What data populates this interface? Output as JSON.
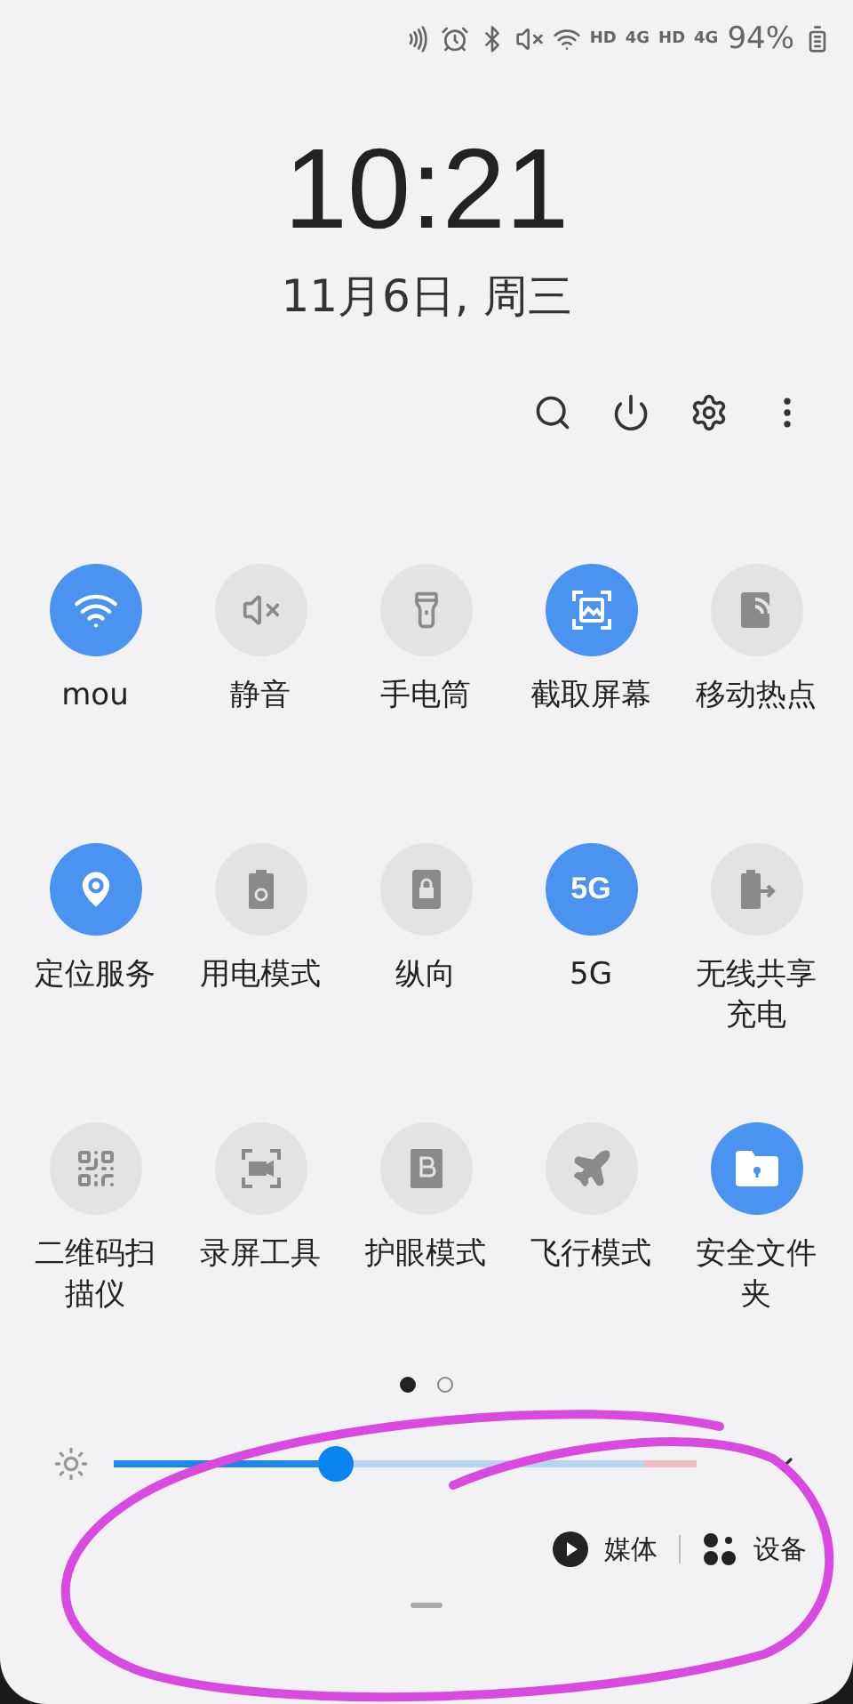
{
  "status_bar": {
    "texts": [
      "HD",
      "4G",
      "HD",
      "4G"
    ],
    "battery": "94%"
  },
  "clock": {
    "time": "10:21",
    "date": "11月6日, 周三"
  },
  "tiles": [
    {
      "label": "mou",
      "on": true
    },
    {
      "label": "静音",
      "on": false
    },
    {
      "label": "手电筒",
      "on": false
    },
    {
      "label": "截取屏幕",
      "on": true
    },
    {
      "label": "移动热点",
      "on": false
    },
    {
      "label": "定位服务",
      "on": true
    },
    {
      "label": "用电模式",
      "on": false
    },
    {
      "label": "纵向",
      "on": false
    },
    {
      "label": "5G",
      "on": true,
      "icon_text": "5G"
    },
    {
      "label": "无线共享充电",
      "on": false
    },
    {
      "label": "二维码扫描仪",
      "on": false
    },
    {
      "label": "录屏工具",
      "on": false
    },
    {
      "label": "护眼模式",
      "on": false
    },
    {
      "label": "飞行模式",
      "on": false
    },
    {
      "label": "安全文件夹",
      "on": true
    }
  ],
  "pages": [
    {
      "selected": true
    },
    {
      "selected": false
    }
  ],
  "brightness": {
    "level": 0.38
  },
  "output": {
    "media": "媒体",
    "devices": "设备"
  }
}
